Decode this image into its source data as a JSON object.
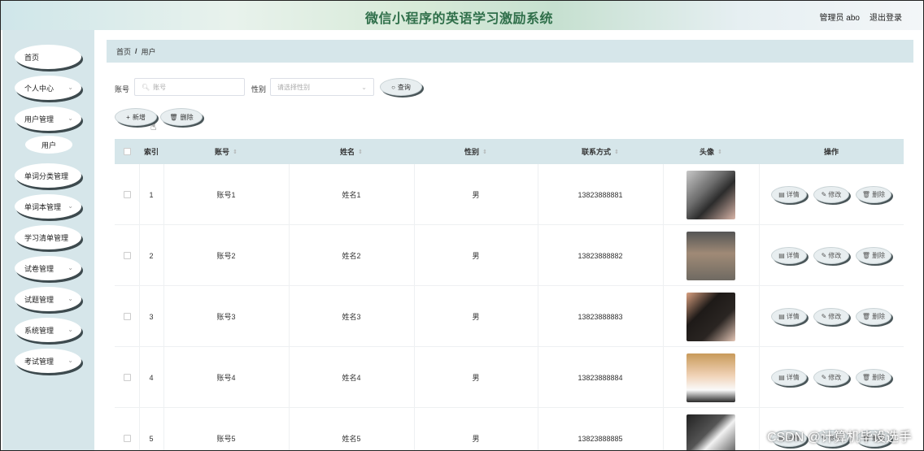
{
  "header": {
    "title": "微信小程序的英语学习激励系统",
    "admin": "管理员 abo",
    "logout": "退出登录"
  },
  "sidebar": {
    "items": [
      {
        "label": "首页",
        "chevron": false
      },
      {
        "label": "个人中心",
        "chevron": true
      },
      {
        "label": "用户管理",
        "chevron": true
      },
      {
        "label": "单词分类管理",
        "chevron": false
      },
      {
        "label": "单词本管理",
        "chevron": true
      },
      {
        "label": "学习清单管理",
        "chevron": false
      },
      {
        "label": "试卷管理",
        "chevron": true
      },
      {
        "label": "试题管理",
        "chevron": true
      },
      {
        "label": "系统管理",
        "chevron": true
      },
      {
        "label": "考试管理",
        "chevron": true
      }
    ],
    "subitem": "用户"
  },
  "breadcrumb": {
    "home": "首页",
    "sep": "/",
    "current": "用户"
  },
  "search": {
    "account_label": "账号",
    "account_placeholder": "账号",
    "gender_label": "性别",
    "gender_placeholder": "请选择性别",
    "query_button": "查询"
  },
  "actions": {
    "add_button": "新增",
    "delete_button": "删除"
  },
  "table": {
    "columns": [
      "索引",
      "账号",
      "姓名",
      "性别",
      "联系方式",
      "头像",
      "操作"
    ],
    "rows": [
      {
        "index": "1",
        "account": "账号1",
        "name": "姓名1",
        "gender": "男",
        "phone": "13823888881"
      },
      {
        "index": "2",
        "account": "账号2",
        "name": "姓名2",
        "gender": "男",
        "phone": "13823888882"
      },
      {
        "index": "3",
        "account": "账号3",
        "name": "姓名3",
        "gender": "男",
        "phone": "13823888883"
      },
      {
        "index": "4",
        "account": "账号4",
        "name": "姓名4",
        "gender": "男",
        "phone": "13823888884"
      },
      {
        "index": "5",
        "account": "账号5",
        "name": "姓名5",
        "gender": "男",
        "phone": "13823888885"
      }
    ],
    "op_labels": {
      "detail": "详情",
      "edit": "修改",
      "delete": "删除"
    }
  },
  "colors": {
    "sidebar_bg": "#d6e6ea",
    "title_green": "#2f6f4a",
    "button_shadow": "#4a5659"
  },
  "watermark": "CSDN @计算机毕设选手"
}
